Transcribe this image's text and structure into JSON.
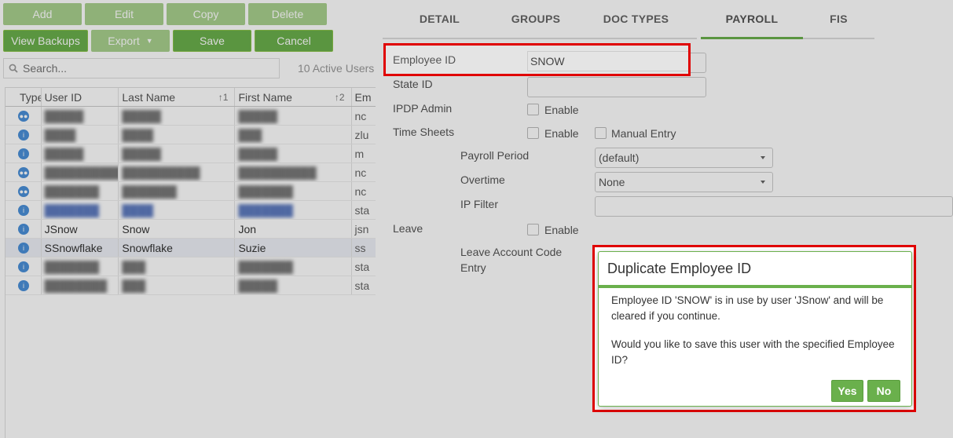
{
  "toolbar": {
    "add": "Add",
    "edit": "Edit",
    "copy": "Copy",
    "delete": "Delete",
    "view_backups": "View Backups",
    "export": "Export",
    "save": "Save",
    "cancel": "Cancel"
  },
  "search": {
    "placeholder": "Search...",
    "active_users": "10 Active Users"
  },
  "grid": {
    "columns": [
      "Type",
      "User ID",
      "Last Name",
      "First Name",
      "Em"
    ],
    "rows": [
      {
        "type_icon": "people-icon",
        "user_id": "█████",
        "last": "█████",
        "first": "█████",
        "em": "nc",
        "redacted": true
      },
      {
        "type_icon": "info-icon",
        "user_id": "████",
        "last": "████",
        "first": "███",
        "em": "zlu",
        "redacted": true
      },
      {
        "type_icon": "info-icon",
        "user_id": "█████",
        "last": "█████",
        "first": "█████",
        "em": "m",
        "redacted": true
      },
      {
        "type_icon": "people-icon",
        "user_id": "██████████",
        "last": "██████████",
        "first": "██████████",
        "em": "nc",
        "redacted": true
      },
      {
        "type_icon": "people-icon",
        "user_id": "███████",
        "last": "███████",
        "first": "███████",
        "em": "nc",
        "redacted": true
      },
      {
        "type_icon": "info-icon",
        "user_id": "███████",
        "last": "████",
        "first": "███████",
        "em": "sta",
        "redacted": true
      },
      {
        "type_icon": "info-icon",
        "user_id": "JSnow",
        "last": "Snow",
        "first": "Jon",
        "em": "jsn",
        "redacted": false
      },
      {
        "type_icon": "info-icon",
        "user_id": "SSnowflake",
        "last": "Snowflake",
        "first": "Suzie",
        "em": "ss",
        "redacted": false,
        "selected": true
      },
      {
        "type_icon": "info-icon",
        "user_id": "███████",
        "last": "███",
        "first": "███████",
        "em": "sta",
        "redacted": true
      },
      {
        "type_icon": "info-icon",
        "user_id": "████████",
        "last": "███",
        "first": "█████",
        "em": "sta",
        "redacted": true
      }
    ]
  },
  "tabs": [
    "DETAIL",
    "GROUPS",
    "DOC TYPES",
    "PAYROLL",
    "FIS"
  ],
  "form": {
    "employee_id_label": "Employee ID",
    "employee_id_value": "SNOW",
    "state_id_label": "State ID",
    "ipdp_admin_label": "IPDP Admin",
    "enable": "Enable",
    "time_sheets_label": "Time Sheets",
    "manual_entry": "Manual Entry",
    "payroll_period_label": "Payroll Period",
    "payroll_period_value": "(default)",
    "overtime_label": "Overtime",
    "overtime_value": "None",
    "ip_filter_label": "IP Filter",
    "leave_label": "Leave",
    "leave_account_label_1": "Leave Account Code",
    "leave_account_label_2": "Entry"
  },
  "dialog": {
    "title": "Duplicate Employee ID",
    "line1": "Employee ID 'SNOW' is in use by user 'JSnow' and will be cleared if you continue.",
    "line2": "Would you like to save this user with the specified Employee ID?",
    "yes": "Yes",
    "no": "No"
  },
  "colors": {
    "accent": "#6ab04c",
    "highlight": "#e00000"
  }
}
